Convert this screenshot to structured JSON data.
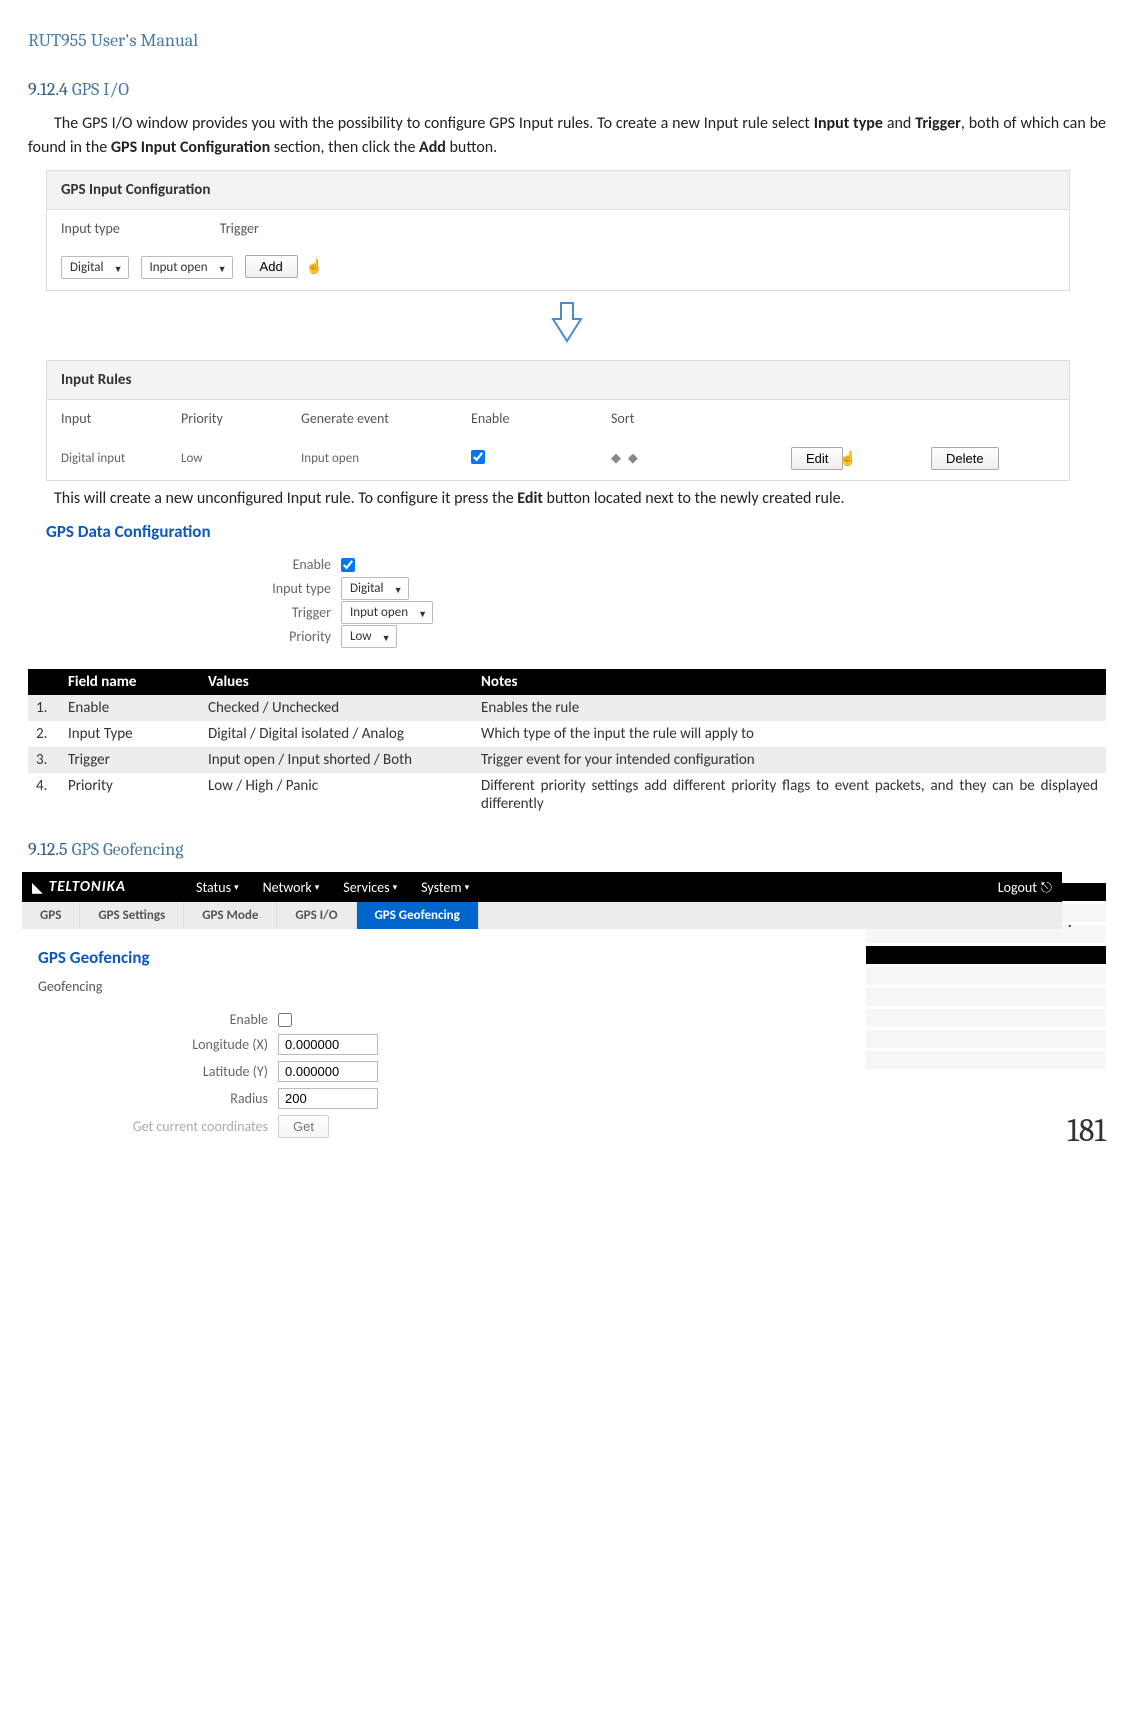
{
  "page_header": "RUT955 User's Manual",
  "sections": {
    "gps_io": {
      "number": "9.12.4",
      "title": "GPS I/O",
      "para1_pre": "The GPS I/O window provides you with the possibility to configure GPS Input rules. To create a new Input rule select ",
      "b1": "Input type",
      "mid1": " and ",
      "b2": "Trigger",
      "mid2": ", both of which can be found in the ",
      "b3": "GPS Input Configuration",
      "mid3": " section, then click the ",
      "b4": "Add",
      "end": " button.",
      "para2_pre": "This will create a new unconfigured Input rule. To configure it press the ",
      "b5": "Edit",
      "para2_end": " button located next to the newly created rule."
    },
    "gps_geo": {
      "number": "9.12.5",
      "title": "GPS Geofencing"
    }
  },
  "panel1": {
    "title": "GPS Input Configuration",
    "col1": "Input type",
    "col2": "Trigger",
    "sel1": "Digital",
    "sel2": "Input open",
    "add_btn": "Add"
  },
  "panel2": {
    "title": "Input Rules",
    "headers": {
      "c1": "Input",
      "c2": "Priority",
      "c3": "Generate event",
      "c4": "Enable",
      "c5": "Sort"
    },
    "row": {
      "c1": "Digital input",
      "c2": "Low",
      "c3": "Input open"
    },
    "edit_btn": "Edit",
    "delete_btn": "Delete"
  },
  "gps_data_config": {
    "title": "GPS Data Configuration",
    "enable_label": "Enable",
    "input_type_label": "Input type",
    "input_type_value": "Digital",
    "trigger_label": "Trigger",
    "trigger_value": "Input open",
    "priority_label": "Priority",
    "priority_value": "Low"
  },
  "field_table": {
    "headers": {
      "name": "Field name",
      "values": "Values",
      "notes": "Notes"
    },
    "rows": [
      {
        "num": "1.",
        "name": "Enable",
        "values": "Checked / Unchecked",
        "notes": "Enables the rule"
      },
      {
        "num": "2.",
        "name": "Input Type",
        "values": "Digital / Digital isolated / Analog",
        "notes": "Which type of the input the rule will apply to"
      },
      {
        "num": "3.",
        "name": "Trigger",
        "values": "Input open / Input shorted / Both",
        "notes": "Trigger event for your intended configuration"
      },
      {
        "num": "4.",
        "name": "Priority",
        "values": "Low / High / Panic",
        "notes": "Different priority settings add different priority flags to event packets, and they can be displayed differently"
      }
    ]
  },
  "nav": {
    "logo": "TELTONIKA",
    "items": [
      "Status",
      "Network",
      "Services",
      "System"
    ],
    "logout": "Logout"
  },
  "tabs": [
    "GPS",
    "GPS Settings",
    "GPS Mode",
    "GPS I/O",
    "GPS Geofencing"
  ],
  "geo_panel": {
    "title": "GPS Geofencing",
    "subtitle": "Geofencing",
    "enable_label": "Enable",
    "lon_label": "Longitude (X)",
    "lon_value": "0.000000",
    "lat_label": "Latitude (Y)",
    "lat_value": "0.000000",
    "radius_label": "Radius",
    "radius_value": "200",
    "get_label": "Get current coordinates",
    "get_btn": "Get"
  },
  "page_number": "181"
}
